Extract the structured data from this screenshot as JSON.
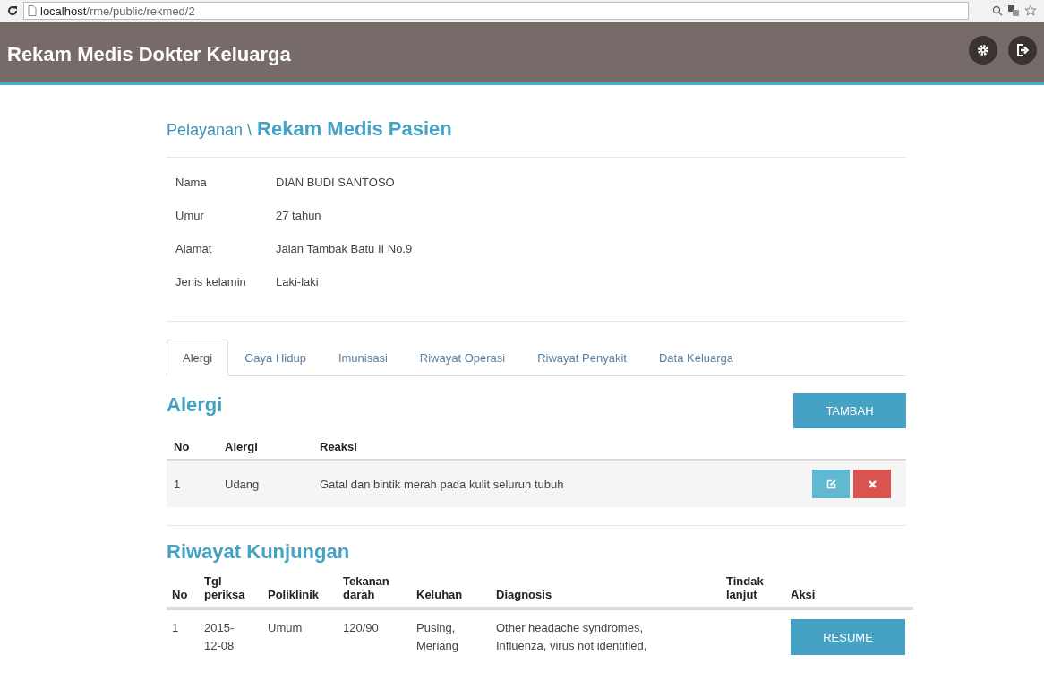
{
  "browser": {
    "url_host": "localhost",
    "url_path": "/rme/public/rekmed/2"
  },
  "app": {
    "title": "Rekam Medis Dokter Keluarga"
  },
  "breadcrumb": {
    "parent": "Pelayanan \\",
    "current": "Rekam Medis Pasien"
  },
  "patient": [
    {
      "label": "Nama",
      "value": "DIAN BUDI SANTOSO"
    },
    {
      "label": "Umur",
      "value": "27 tahun"
    },
    {
      "label": "Alamat",
      "value": "Jalan Tambak Batu II No.9"
    },
    {
      "label": "Jenis kelamin",
      "value": "Laki-laki"
    }
  ],
  "tabs": [
    {
      "label": "Alergi",
      "selected": true
    },
    {
      "label": "Gaya Hidup",
      "selected": false
    },
    {
      "label": "Imunisasi",
      "selected": false
    },
    {
      "label": "Riwayat Operasi",
      "selected": false
    },
    {
      "label": "Riwayat Penyakit",
      "selected": false
    },
    {
      "label": "Data Keluarga",
      "selected": false
    }
  ],
  "allergy": {
    "heading": "Alergi",
    "add_button": "TAMBAH",
    "columns": [
      "No",
      "Alergi",
      "Reaksi"
    ],
    "rows": [
      [
        "1",
        "Udang",
        "Gatal dan bintik merah pada kulit seluruh tubuh"
      ]
    ]
  },
  "visits": {
    "heading": "Riwayat Kunjungan",
    "columns": [
      "No",
      "Tgl periksa",
      "Poliklinik",
      "Tekanan darah",
      "Keluhan",
      "Diagnosis",
      "Tindak lanjut",
      "Aksi"
    ],
    "rows": [
      {
        "cells": [
          "1",
          "2015-12-08",
          "Umum",
          "120/90",
          "Pusing, Meriang",
          "Other headache syndromes, Influenza, virus not identified,",
          ""
        ],
        "button": "RESUME"
      }
    ]
  }
}
